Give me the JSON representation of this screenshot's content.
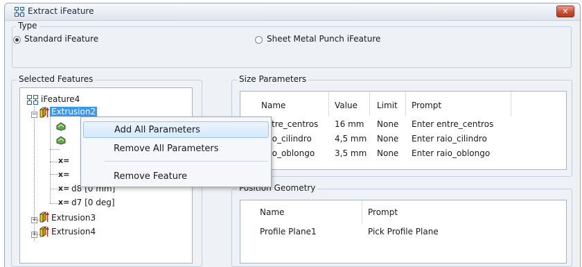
{
  "window": {
    "title": "Extract iFeature",
    "close_glyph": "✕",
    "title_icon": "ifeature-extract-icon",
    "close_color": "#c94e33"
  },
  "type_group": {
    "label": "Type",
    "options": [
      {
        "label": "Standard iFeature",
        "selected": true
      },
      {
        "label": "Sheet Metal Punch iFeature",
        "selected": false
      }
    ]
  },
  "selected_features": {
    "label": "Selected Features",
    "root": "iFeature4",
    "extrusion2": "Extrusion2",
    "param_prefix": "x=",
    "param_d8": "d8 [0 mm]",
    "param_d7": "d7 [0 deg]",
    "extrusion3": "Extrusion3",
    "extrusion4": "Extrusion4",
    "selected_highlight": "#3399ff"
  },
  "size_parameters": {
    "label": "Size Parameters",
    "headers": [
      "Name",
      "Value",
      "Limit",
      "Prompt"
    ],
    "rows": [
      {
        "name": "entre_centros",
        "value": "16 mm",
        "limit": "None",
        "prompt": "Enter entre_centros"
      },
      {
        "name": "raio_cilindro",
        "value": "4,5 mm",
        "limit": "None",
        "prompt": "Enter raio_cilindro"
      },
      {
        "name": "raio_oblongo",
        "value": "3,5 mm",
        "limit": "None",
        "prompt": "Enter raio_oblongo"
      }
    ]
  },
  "position_geometry": {
    "label": "Position Geometry",
    "headers": [
      "Name",
      "Prompt"
    ],
    "rows": [
      {
        "name": "Profile Plane1",
        "prompt": "Pick Profile Plane"
      }
    ]
  },
  "context_menu": {
    "items": [
      {
        "label": "Add  All Parameters",
        "hovered": true
      },
      {
        "label": "Remove All Parameters",
        "hovered": false
      },
      {
        "label": "Remove Feature",
        "hovered": false
      }
    ]
  }
}
